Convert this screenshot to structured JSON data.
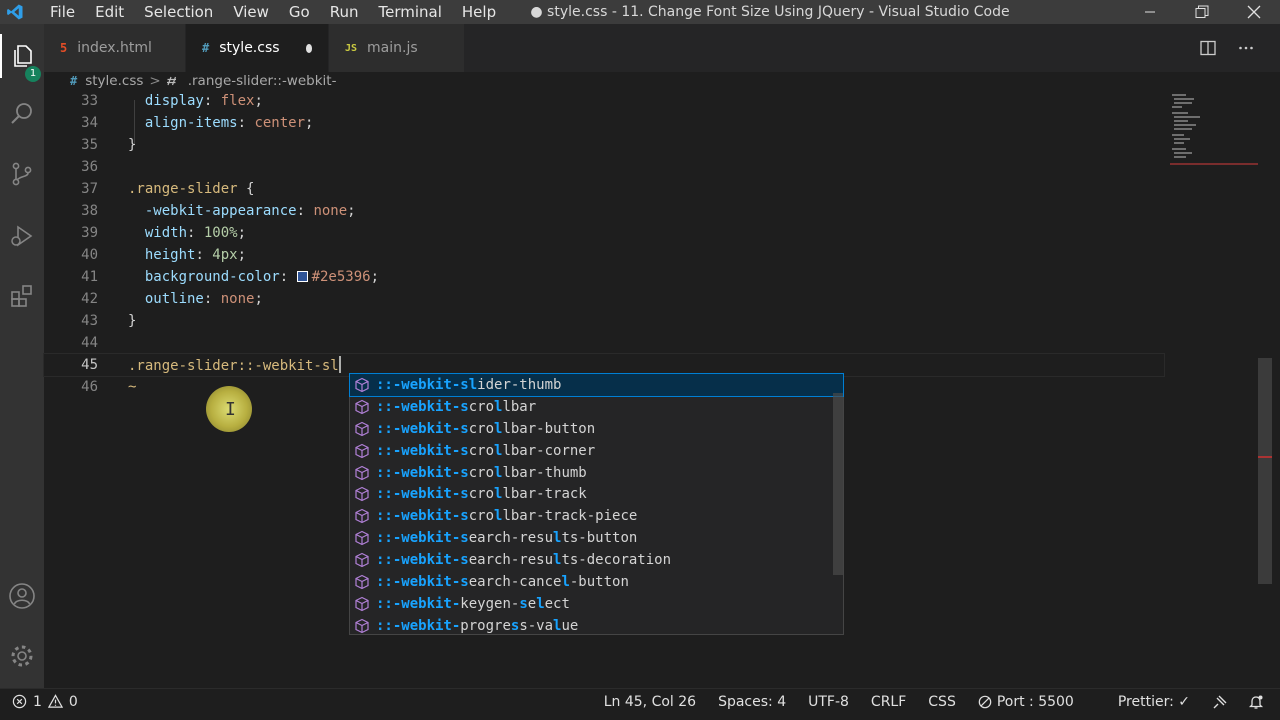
{
  "window_title": "● style.css - 11. Change Font Size Using JQuery - Visual Studio Code",
  "menu": [
    "File",
    "Edit",
    "Selection",
    "View",
    "Go",
    "Run",
    "Terminal",
    "Help"
  ],
  "activity": {
    "explorer_badge": "1"
  },
  "tabs": [
    {
      "label": "index.html",
      "icon": "5",
      "icon_color": "#e44d26"
    },
    {
      "label": "style.css",
      "icon": "#",
      "icon_color": "#519aba",
      "active": true,
      "dirty": true
    },
    {
      "label": "main.js",
      "icon": "JS",
      "icon_color": "#cbcb41"
    }
  ],
  "breadcrumb": {
    "file": "style.css",
    "separator": ">",
    "symbol": ".range-slider::-webkit-"
  },
  "editor": {
    "line_numbers": [
      "33",
      "34",
      "35",
      "36",
      "37",
      "38",
      "39",
      "40",
      "41",
      "42",
      "43",
      "44",
      "45",
      "46"
    ],
    "color_swatch": "#2e5396",
    "l33": {
      "prop": "display",
      "colon": ": ",
      "value": "flex",
      "semi": ";"
    },
    "l34": {
      "prop": "align-items",
      "colon": ": ",
      "value": "center",
      "semi": ";"
    },
    "l35": "}",
    "l37": {
      "selector": ".range-slider",
      "brace": " {"
    },
    "l38": {
      "prop": "-webkit-appearance",
      "colon": ": ",
      "value": "none",
      "semi": ";"
    },
    "l39": {
      "prop": "width",
      "colon": ": ",
      "value": "100%",
      "semi": ";"
    },
    "l40": {
      "prop": "height",
      "colon": ": ",
      "value": "4px",
      "semi": ";"
    },
    "l41": {
      "prop": "background-color",
      "colon": ": ",
      "value": "#2e5396",
      "semi": ";"
    },
    "l42": {
      "prop": "outline",
      "colon": ": ",
      "value": "none",
      "semi": ";"
    },
    "l43": "}",
    "l45": {
      "selector": ".range-slider::-webkit-sl"
    },
    "l46": "~"
  },
  "suggestions": [
    {
      "prefix": "::-webkit-s",
      "mid": "l",
      "rest": "ider-thumb",
      "mid2": "",
      "tail": ""
    },
    {
      "prefix": "::-webkit-s",
      "mid": "",
      "rest": "cro",
      "mid2": "l",
      "tail": "lbar"
    },
    {
      "prefix": "::-webkit-s",
      "mid": "",
      "rest": "cro",
      "mid2": "l",
      "tail": "lbar-button"
    },
    {
      "prefix": "::-webkit-s",
      "mid": "",
      "rest": "cro",
      "mid2": "l",
      "tail": "lbar-corner"
    },
    {
      "prefix": "::-webkit-s",
      "mid": "",
      "rest": "cro",
      "mid2": "l",
      "tail": "lbar-thumb"
    },
    {
      "prefix": "::-webkit-s",
      "mid": "",
      "rest": "cro",
      "mid2": "l",
      "tail": "lbar-track"
    },
    {
      "prefix": "::-webkit-s",
      "mid": "",
      "rest": "cro",
      "mid2": "l",
      "tail": "lbar-track-piece"
    },
    {
      "prefix": "::-webkit-s",
      "mid": "",
      "rest": "earch-resu",
      "mid2": "l",
      "tail": "ts-button"
    },
    {
      "prefix": "::-webkit-s",
      "mid": "",
      "rest": "earch-resu",
      "mid2": "l",
      "tail": "ts-decoration"
    },
    {
      "prefix": "::-webkit-s",
      "mid": "",
      "rest": "earch-cance",
      "mid2": "l",
      "tail": "-button"
    },
    {
      "prefix": "::-webkit-",
      "mid": "",
      "rest": "keygen-",
      "mid2": "s",
      "tail": "e",
      "mid3": "l",
      "tail2": "ect"
    },
    {
      "prefix": "::-webkit-",
      "mid": "",
      "rest": "progre",
      "mid2": "s",
      "tail": "s-va",
      "mid3": "l",
      "tail2": "ue"
    }
  ],
  "status": {
    "errors": "1",
    "warnings": "0",
    "position": "Ln 45, Col 26",
    "spaces": "Spaces: 4",
    "encoding": "UTF-8",
    "eol": "CRLF",
    "language": "CSS",
    "port": "Port : 5500",
    "prettier": "Prettier: ✓"
  }
}
